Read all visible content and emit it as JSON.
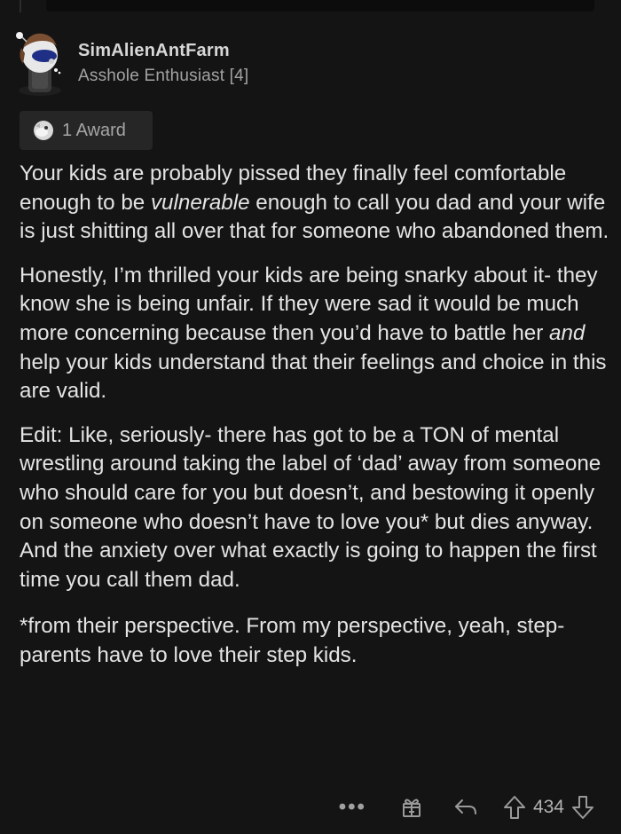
{
  "comment": {
    "username": "SimAlienAntFarm",
    "flair": "Asshole Enthusiast [4]",
    "award_label": "1 Award",
    "paragraphs": {
      "p1": {
        "a": "Your kids are probably pissed they finally feel comfortable enough to be ",
        "em": "vulnerable",
        "b": " enough to call you dad and your wife is just shitting all over that for someone who abandoned them."
      },
      "p2": {
        "a": "Honestly, I’m thrilled your kids are being snarky about it- they know she is being unfair. If they were sad it would be much more concerning because then you’d have to battle her ",
        "em": "and",
        "b": " help your kids understand that their feelings and choice in this are valid."
      },
      "p3": "Edit: Like, seriously- there has got to be a TON of mental wrestling around taking the label of ‘dad’ away from someone who should care for you but doesn’t, and bestowing it openly on someone who doesn’t have to love you* but dies anyway. And the anxiety over what exactly is going to happen the first time you call them dad.",
      "p4": "*from their perspective. From my perspective, yeah, step-parents have to love their step kids."
    },
    "actions": {
      "more_label": "•••",
      "score": "434"
    }
  },
  "colors": {
    "background": "#141414",
    "text": "#e4e4e4",
    "muted": "#a3a3a3",
    "award_bg": "#262626"
  },
  "icons": [
    "avatar",
    "award-icon",
    "more-icon",
    "gift-icon",
    "reply-icon",
    "upvote-icon",
    "downvote-icon"
  ]
}
